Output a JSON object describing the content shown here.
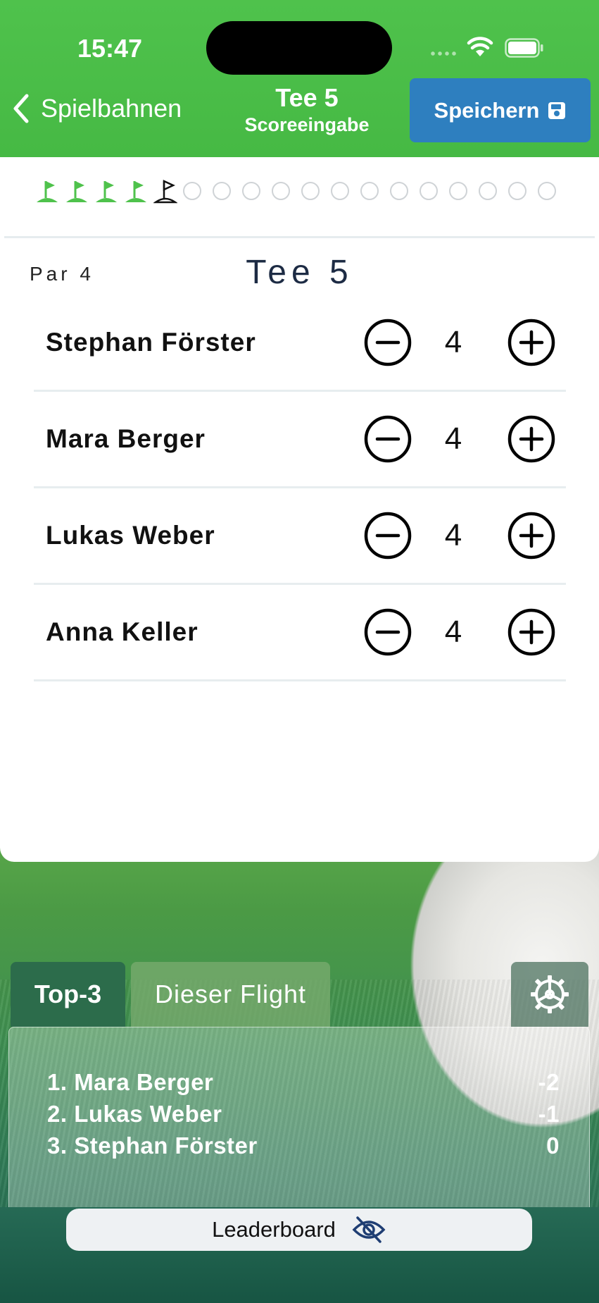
{
  "status_bar": {
    "time": "15:47"
  },
  "nav": {
    "back_label": "Spielbahnen",
    "title": "Tee 5",
    "subtitle": "Scoreeingabe",
    "save_label": "Speichern",
    "save_icon": "floppy-disk-icon"
  },
  "progress": {
    "completed_holes": 4,
    "current_hole": 5,
    "total_holes": 18,
    "accent": "#4fc24c"
  },
  "hole": {
    "par_label": "Par 4",
    "tee_label": "Tee 5"
  },
  "players": [
    {
      "name": "Stephan Förster",
      "score": "4"
    },
    {
      "name": "Mara Berger",
      "score": "4"
    },
    {
      "name": "Lukas Weber",
      "score": "4"
    },
    {
      "name": "Anna Keller",
      "score": "4"
    }
  ],
  "leaderboard": {
    "tabs": [
      {
        "label": "Top-3",
        "active": true
      },
      {
        "label": "Dieser Flight",
        "active": false
      }
    ],
    "settings_icon": "gear-icon",
    "entries": [
      {
        "rank_name": "1. Mara Berger",
        "score": "-2"
      },
      {
        "rank_name": "2. Lukas Weber",
        "score": "-1"
      },
      {
        "rank_name": "3. Stephan Förster",
        "score": "0"
      }
    ],
    "toggle_label": "Leaderboard",
    "toggle_icon": "eye-slash-icon"
  }
}
